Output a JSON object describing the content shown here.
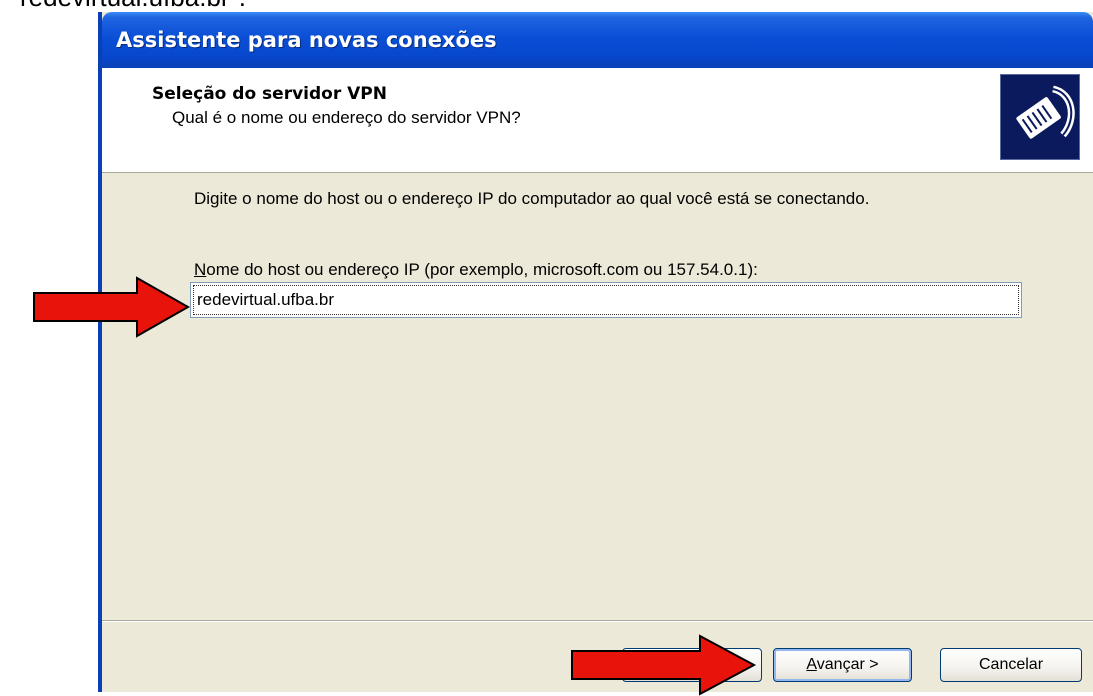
{
  "caption": "redevirtual.ufba.br\".",
  "window": {
    "title": "Assistente para novas conexões"
  },
  "header": {
    "title": "Seleção do servidor VPN",
    "subtitle": "Qual é o nome ou endereço do servidor VPN?",
    "icon": "network-cable-icon"
  },
  "content": {
    "instruction": "Digite o nome do host ou o endereço IP do computador ao qual você está se conectando.",
    "field_label_mnemonic": "N",
    "field_label_rest": "ome do host ou endereço IP (por exemplo, microsoft.com ou 157.54.0.1):",
    "host_value": "redevirtual.ufba.br"
  },
  "buttons": {
    "back_label": "",
    "next_mnemonic": "A",
    "next_rest": "vançar >",
    "cancel_label": "Cancelar"
  },
  "annotations": {
    "arrow_color": "#e8140c",
    "arrow_icon": "red-arrow-right-icon"
  }
}
